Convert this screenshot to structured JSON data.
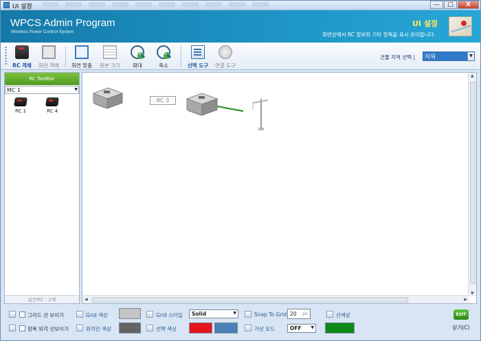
{
  "window": {
    "title": "UI 설정",
    "controls": [
      "—",
      "□",
      "X"
    ]
  },
  "banner": {
    "app_title": "WPCS Admin Program",
    "app_subtitle": "Wireless Power Control System",
    "section_title": "UI 설정",
    "section_desc": "화면상에서 RC 정보와 기타 항목을 표시 관리합니다."
  },
  "toolbar": {
    "items": [
      {
        "label": "RC 객체",
        "icon": "rc-device-icon",
        "state": "active"
      },
      {
        "label": "화면 객체",
        "icon": "monitor-icon",
        "state": "disabled"
      },
      {
        "label": "화면 맞춤",
        "icon": "fit-screen-icon",
        "state": "normal"
      },
      {
        "label": "원본 크기",
        "icon": "original-size-icon",
        "state": "disabled"
      },
      {
        "label": "확대",
        "icon": "zoom-in-icon",
        "state": "normal"
      },
      {
        "label": "축소",
        "icon": "zoom-out-icon",
        "state": "normal"
      },
      {
        "label": "선택 도구",
        "icon": "select-tool-icon",
        "state": "active"
      },
      {
        "label": "연결 도구",
        "icon": "connect-tool-icon",
        "state": "disabled"
      }
    ],
    "region_label": "건물 지역 선택 |",
    "region_value": "타워"
  },
  "left_panel": {
    "header": "RC ToolBar",
    "mc_value": "MC 1",
    "items": [
      {
        "label": "RC 1"
      },
      {
        "label": "RC 4"
      }
    ],
    "remaining": "남은RC - 2개"
  },
  "canvas": {
    "rc3_label": "RC 3",
    "line_color": "#1c8a1c"
  },
  "bottom": {
    "grid_show": "그리드 선 보이기",
    "outline_show": "항목 외각 선보이기",
    "grid_color_label": "Grid 색상",
    "outline_color_label": "외각선 색상",
    "grid_style_label": "Grid 스타일",
    "grid_style_value": "Solid",
    "select_color_label": "선택 색상",
    "snap_label": "Snap To Grid",
    "snap_value": "20",
    "snap_unit": "px",
    "virtual_mode_label": "가상 모드",
    "virtual_mode_value": "OFF",
    "line_color_label": "선색상",
    "colors": {
      "grid": "#c4c4c4",
      "outline": "#646464",
      "select_red": "#e6141e",
      "select_blue": "#4a7fb8",
      "line": "#0d8a18"
    },
    "exit_icon_text": "EXIT",
    "close_label": "닫기(C)"
  }
}
